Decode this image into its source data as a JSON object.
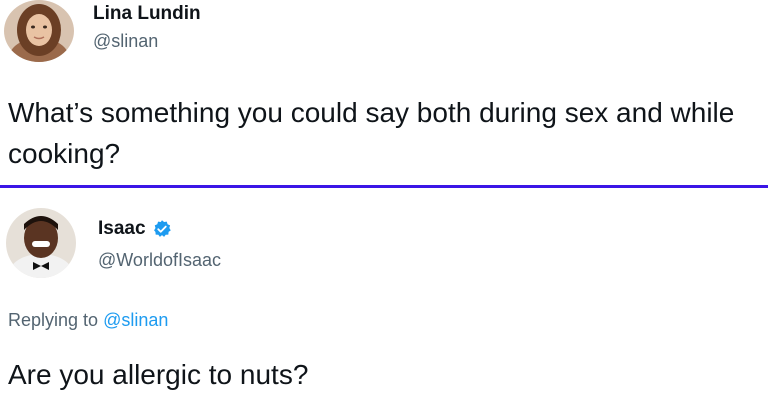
{
  "tweet1": {
    "author_name": "Lina Lundin",
    "author_handle": "@slinan",
    "text": "What’s something you could say both during sex and while cooking?"
  },
  "tweet2": {
    "author_name": "Isaac",
    "author_handle": "@WorldofIsaac",
    "verified_icon": "verified-badge-icon",
    "replying_prefix": "Replying to",
    "replying_handle": "@slinan",
    "text": "Are you allergic to nuts?"
  },
  "colors": {
    "divider": "#3b16e6",
    "link": "#1d9bf0",
    "verified": "#1d9bf0",
    "secondary_text": "#536471"
  }
}
